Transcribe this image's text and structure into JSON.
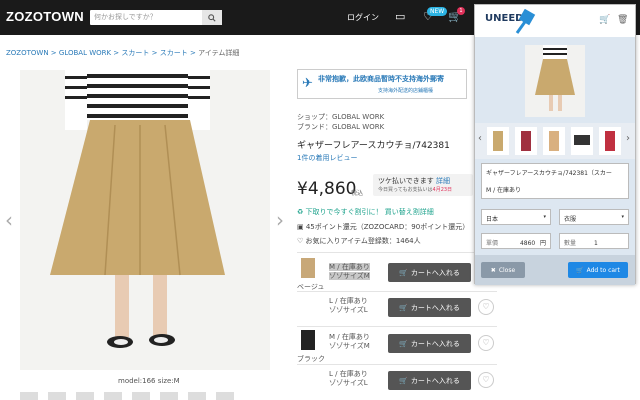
{
  "header": {
    "logo": "ZOZOTOWN",
    "search_placeholder": "何かお探しですか？",
    "login": "ログイン",
    "new_badge": "NEW",
    "cart_count": "1"
  },
  "breadcrumb": [
    "ZOZOTOWN",
    "GLOBAL WORK",
    "スカート",
    "スカート",
    "アイテム詳細"
  ],
  "image_caption": "model:166 size:M",
  "notice": {
    "title": "非常抱歉，此欧商品暫時不支持海外郵寄",
    "sub": "支持海外配送的店鋪櫃檯"
  },
  "product": {
    "shop": "ショップ：GLOBAL WORK",
    "brand": "ブランド：GLOBAL WORK",
    "title": "ギャザーフレアースカウチョ/742381",
    "reviews": "1件の着用レビュー",
    "price": "¥4,860",
    "tax": "税込",
    "tsuke_line1": "ツケ払いできます",
    "tsuke_link": "詳細",
    "tsuke_line2_a": "今日買ってもお支払いは",
    "tsuke_line2_b": "4月23日",
    "price_down": "下取りで今すぐ割引に！ 買い替え割詳細",
    "points": "45ポイント還元（ZOZOCARD：90ポイント還元）",
    "favorites": "お気に入りアイテム登録数：1464人"
  },
  "variants": [
    {
      "color": "ベージュ",
      "swatch": "#c8a878",
      "sizes": [
        {
          "label": "M / 在庫あり",
          "sub": "ゾゾサイズM",
          "hl": true
        }
      ]
    },
    {
      "color": "",
      "swatch": "",
      "sizes": [
        {
          "label": "L / 在庫あり",
          "sub": "ゾゾサイズL",
          "hl": false
        }
      ]
    },
    {
      "color": "ブラック",
      "swatch": "#222222",
      "sizes": [
        {
          "label": "M / 在庫あり",
          "sub": "ゾゾサイズM",
          "hl": false
        }
      ]
    },
    {
      "color": "",
      "swatch": "",
      "sizes": [
        {
          "label": "L / 在庫あり",
          "sub": "ゾゾサイズL",
          "hl": false
        }
      ]
    }
  ],
  "cart_button": "カートへ入れる",
  "panel": {
    "logo": "UNEED",
    "product_name": "ギャザーフレアースカウチョ/742381（スカー",
    "variant": "M / 在庫あり",
    "country": "日本",
    "category": "衣服",
    "price_label": "單價",
    "price_value": "4860",
    "price_unit": "円",
    "qty_label": "數量",
    "qty_value": "1",
    "close": "Close",
    "add": "Add to cart"
  }
}
